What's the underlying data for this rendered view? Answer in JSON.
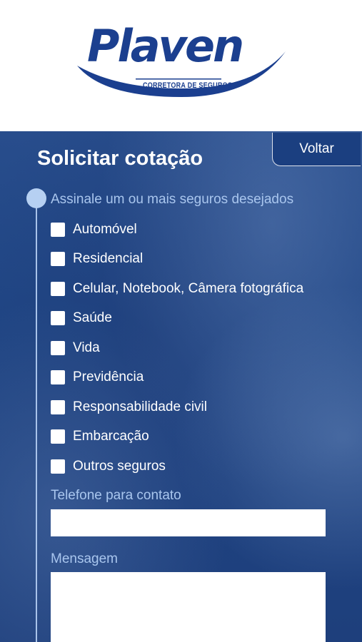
{
  "logo": {
    "brand": "Plaven",
    "tagline": "CORRETORA DE SEGUROS"
  },
  "form": {
    "title": "Solicitar cotação",
    "back_label": "Voltar",
    "instructions": "Assinale um ou mais seguros desejados",
    "options": [
      {
        "label": "Automóvel",
        "checked": false
      },
      {
        "label": "Residencial",
        "checked": false
      },
      {
        "label": "Celular, Notebook, Câmera fotográfica",
        "checked": false
      },
      {
        "label": "Saúde",
        "checked": false
      },
      {
        "label": "Vida",
        "checked": false
      },
      {
        "label": "Previdência",
        "checked": false
      },
      {
        "label": "Responsabilidade civil",
        "checked": false
      },
      {
        "label": "Embarcação",
        "checked": false
      },
      {
        "label": "Outros seguros",
        "checked": false
      }
    ],
    "phone": {
      "label": "Telefone para contato",
      "value": "",
      "placeholder": ""
    },
    "message": {
      "label": "Mensagem",
      "value": "",
      "placeholder": ""
    }
  },
  "colors": {
    "brand_blue": "#1b3f8f",
    "panel_blue": "#1f4584",
    "accent_light_blue": "#a9c6ee"
  }
}
